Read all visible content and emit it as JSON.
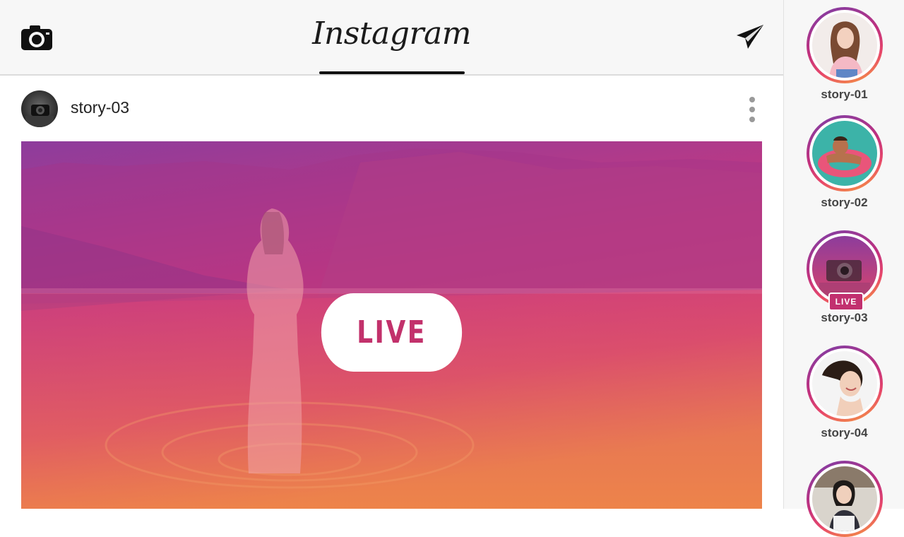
{
  "header": {
    "title": "Instagram",
    "camera_icon": "camera-icon",
    "send_icon": "paper-plane-icon"
  },
  "post": {
    "username": "story-03",
    "more_icon": "more-vertical-icon",
    "live_label": "LIVE"
  },
  "stories": [
    {
      "label": "story-01",
      "live": false
    },
    {
      "label": "story-02",
      "live": false
    },
    {
      "label": "story-03",
      "live": true,
      "badge": "LIVE"
    },
    {
      "label": "story-04",
      "live": false
    },
    {
      "label": "",
      "live": false
    }
  ],
  "colors": {
    "accent": "#c2316b",
    "gradient_top": "#8d3c9c",
    "gradient_mid": "#cc3a7a",
    "gradient_bottom": "#e9804a"
  }
}
